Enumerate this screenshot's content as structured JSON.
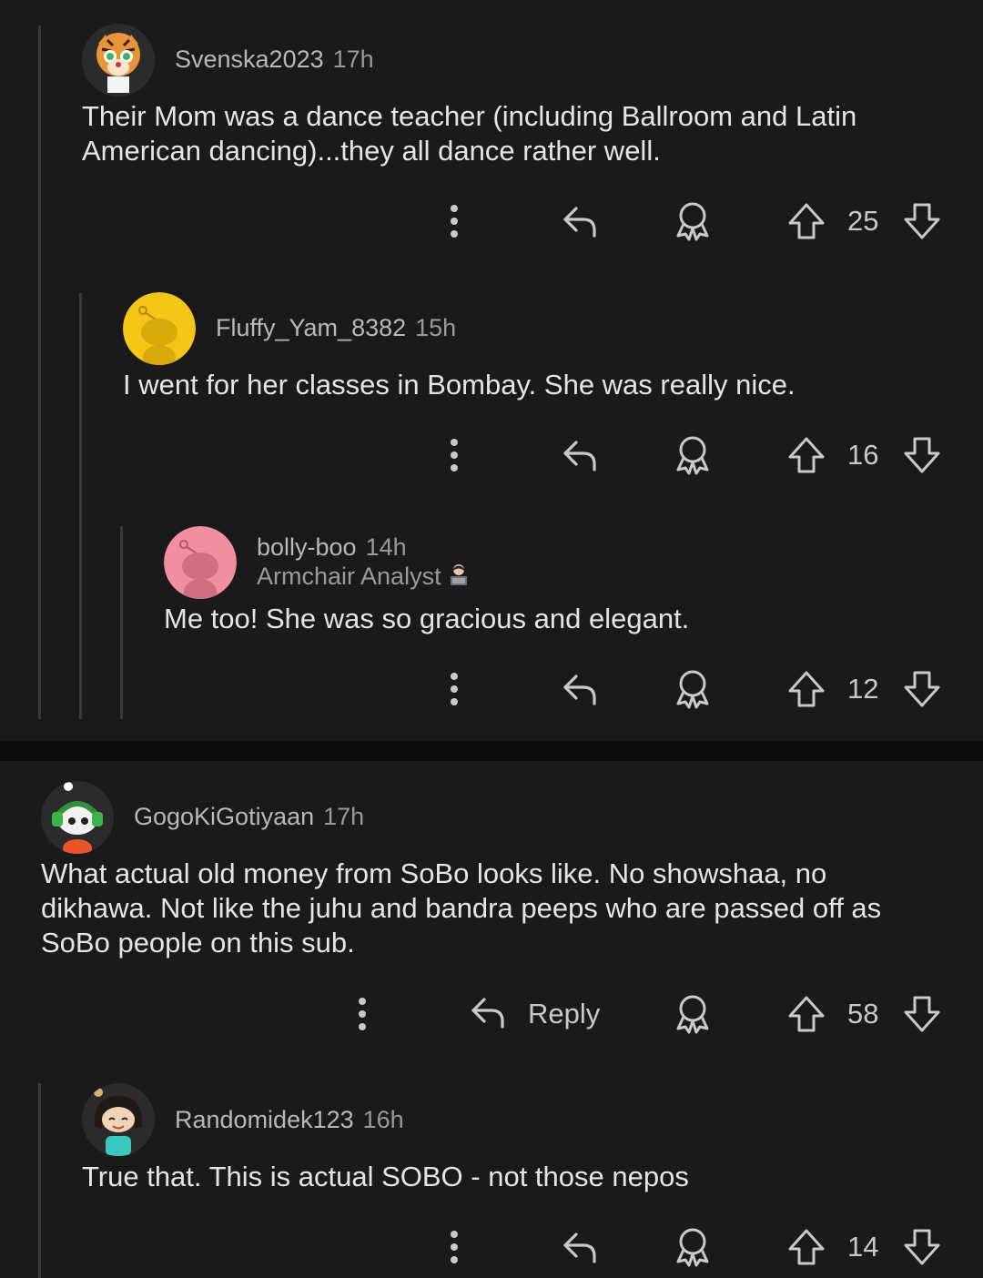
{
  "comments": [
    {
      "username": "Svenska2023",
      "time": "17h",
      "text": "Their Mom was a dance teacher (including Ballroom and Latin American dancing)...they all dance rather well.",
      "votes": "25",
      "avatar_icon": "tiger-avatar-icon"
    },
    {
      "username": "Fluffy_Yam_8382",
      "time": "15h",
      "text": "I went for her classes in Bombay. She was really nice.",
      "votes": "16",
      "avatar_icon": "yellow-snoo-avatar-icon",
      "avatar_color": "#f5c518"
    },
    {
      "username": "bolly-boo",
      "time": "14h",
      "flair": "Armchair Analyst",
      "text": "Me too! She was so gracious and elegant.",
      "votes": "12",
      "avatar_icon": "pink-snoo-avatar-icon",
      "avatar_color": "#f08fa0"
    },
    {
      "username": "GogoKiGotiyaan",
      "time": "17h",
      "text": "What actual old money from SoBo looks like. No showshaa, no dikhawa. Not like the juhu and bandra peeps who are passed off as SoBo people on this sub.",
      "votes": "58",
      "reply_label": "Reply",
      "avatar_icon": "headphones-snoo-avatar-icon"
    },
    {
      "username": "Randomidek123",
      "time": "16h",
      "text": "True that. This is actual SOBO - not those nepos",
      "votes": "14",
      "avatar_icon": "girl-snoo-avatar-icon"
    }
  ],
  "icons": {
    "more": "more-vertical-icon",
    "reply": "reply-arrow-icon",
    "award": "award-icon",
    "upvote": "upvote-arrow-icon",
    "downvote": "downvote-arrow-icon"
  },
  "colors": {
    "background": "#1a1a1b",
    "separator": "#0b0b0b",
    "text": "#e3e5e7",
    "meta": "#9a9a9c"
  }
}
